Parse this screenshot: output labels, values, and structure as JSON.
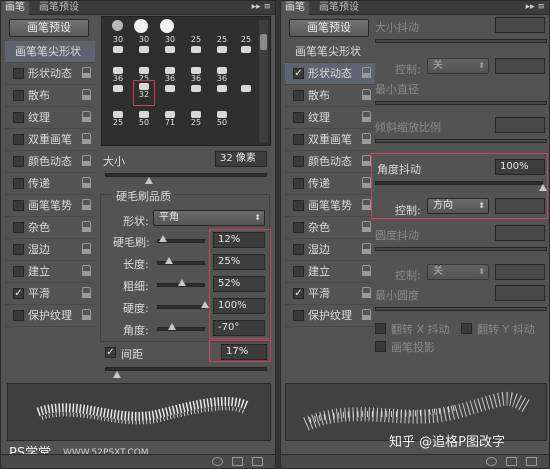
{
  "left": {
    "tabs": [
      "画笔",
      "画笔预设"
    ],
    "preset_button": "画笔预设",
    "sidebar": [
      {
        "label": "画笔笔尖形状",
        "checked": null
      },
      {
        "label": "形状动态",
        "checked": false
      },
      {
        "label": "散布",
        "checked": false
      },
      {
        "label": "纹理",
        "checked": false
      },
      {
        "label": "双重画笔",
        "checked": false
      },
      {
        "label": "颜色动态",
        "checked": false
      },
      {
        "label": "传递",
        "checked": false
      },
      {
        "label": "画笔笔势",
        "checked": false
      },
      {
        "label": "杂色",
        "checked": false
      },
      {
        "label": "湿边",
        "checked": false
      },
      {
        "label": "建立",
        "checked": false
      },
      {
        "label": "平滑",
        "checked": true
      },
      {
        "label": "保护纹理",
        "checked": false
      }
    ],
    "brush_sizes": [
      "30",
      "30",
      "30",
      "25",
      "25",
      "25",
      "36",
      "25",
      "36",
      "36",
      "36",
      "32",
      "25",
      "50",
      "71",
      "25",
      "50"
    ],
    "size_label": "大小",
    "size_value": "32 像素",
    "bristle_quality": "硬毛刷品质",
    "shape_label": "形状:",
    "shape_value": "平角",
    "params": [
      {
        "label": "硬毛刷:",
        "value": "12%",
        "level": 12
      },
      {
        "label": "长度:",
        "value": "25%",
        "level": 25
      },
      {
        "label": "粗细:",
        "value": "52%",
        "level": 52
      },
      {
        "label": "硬度:",
        "value": "100%",
        "level": 100
      },
      {
        "label": "角度:",
        "value": "-70°",
        "level": 40
      }
    ],
    "spacing_label": "间距",
    "spacing_value": "17%",
    "spacing_checked": true,
    "watermark": "PS学堂",
    "watermark_url": "WWW.52PSXT.COM"
  },
  "right": {
    "tabs": [
      "画笔",
      "画笔预设"
    ],
    "preset_button": "画笔预设",
    "sidebar": [
      {
        "label": "画笔笔尖形状",
        "checked": null
      },
      {
        "label": "形状动态",
        "checked": true
      },
      {
        "label": "散布",
        "checked": false
      },
      {
        "label": "纹理",
        "checked": false
      },
      {
        "label": "双重画笔",
        "checked": false
      },
      {
        "label": "颜色动态",
        "checked": false
      },
      {
        "label": "传递",
        "checked": false
      },
      {
        "label": "画笔笔势",
        "checked": false
      },
      {
        "label": "杂色",
        "checked": false
      },
      {
        "label": "湿边",
        "checked": false
      },
      {
        "label": "建立",
        "checked": false
      },
      {
        "label": "平滑",
        "checked": true
      },
      {
        "label": "保护纹理",
        "checked": false
      }
    ],
    "size_jitter": "大小抖动",
    "control_label": "控制:",
    "control_off": "关",
    "min_diameter": "最小直径",
    "tilt_scale": "倾斜缩放比例",
    "angle_jitter": "角度抖动",
    "angle_jitter_value": "100%",
    "angle_control": "方向",
    "roundness_jitter": "圆度抖动",
    "roundness_control": "关",
    "min_roundness": "最小圆度",
    "flip_x": "翻转 X 抖动",
    "flip_y": "翻转 Y 抖动",
    "brush_projection": "画笔投影",
    "watermark": "知乎 @追格P图改字"
  }
}
